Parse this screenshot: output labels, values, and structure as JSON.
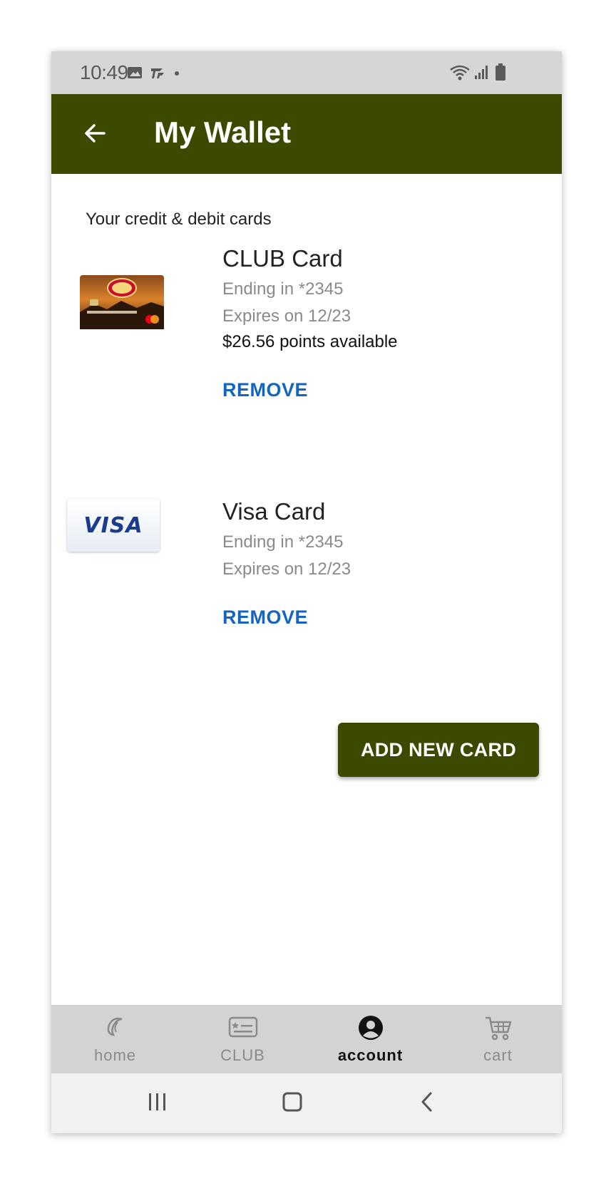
{
  "status_bar": {
    "time": "10:49",
    "left_icons": [
      "image-icon",
      "cast-icon",
      "dot-icon"
    ],
    "right_icons": [
      "wifi-icon",
      "signal-icon",
      "battery-icon"
    ]
  },
  "app_bar": {
    "title": "My Wallet",
    "back_icon": "arrow-left-icon",
    "color": "#3c4a00"
  },
  "section_title": "Your credit & debit cards",
  "cards": [
    {
      "name": "CLUB Card",
      "ending": "Ending in *2345",
      "expires": "Expires on 12/23",
      "points": "$26.56 points available",
      "remove_label": "REMOVE",
      "image": "bass-pro-club-card"
    },
    {
      "name": "Visa Card",
      "ending": "Ending in *2345",
      "expires": "Expires on 12/23",
      "remove_label": "REMOVE",
      "image": "visa-card",
      "logo_text": "VISA"
    }
  ],
  "add_card_label": "ADD NEW CARD",
  "bottom_nav": {
    "items": [
      {
        "label": "home",
        "icon": "home-logo-icon",
        "active": false
      },
      {
        "label": "CLUB",
        "icon": "club-card-icon",
        "active": false
      },
      {
        "label": "account",
        "icon": "account-icon",
        "active": true
      },
      {
        "label": "cart",
        "icon": "cart-icon",
        "active": false
      }
    ]
  },
  "system_nav": [
    "recents-icon",
    "home-icon",
    "back-icon"
  ],
  "colors": {
    "accent": "#3c4a00",
    "link": "#1565c0"
  }
}
